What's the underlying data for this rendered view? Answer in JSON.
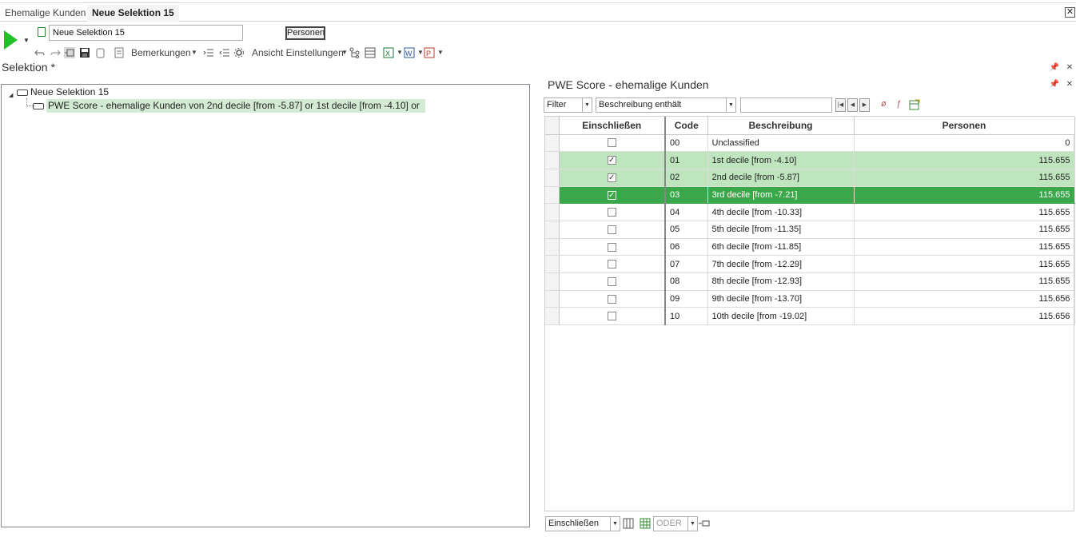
{
  "tabs": [
    {
      "label": "Ehemalige Kunden",
      "active": false
    },
    {
      "label": "Neue Selektion 15",
      "active": true
    }
  ],
  "toolbar": {
    "selection_name": "Neue Selektion 15",
    "persons_button": "Personen",
    "remarks_label": "Bemerkungen",
    "view_settings_label": "Ansicht Einstellungen"
  },
  "selection": {
    "heading": "Selektion *",
    "root": "Neue Selektion 15",
    "child": "PWE Score - ehemalige Kunden von 2nd decile [from -5.87] or 1st decile [from -4.10] or ..."
  },
  "panel": {
    "title": "PWE Score - ehemalige Kunden",
    "filter_mode": "Filter",
    "filter_field": "Beschreibung enthält",
    "filter_text": ""
  },
  "grid": {
    "columns": [
      "Einschließen",
      "Code",
      "Beschreibung",
      "Personen"
    ],
    "rows": [
      {
        "checked": false,
        "code": "00",
        "desc": "Unclassified",
        "persons": "0",
        "state": "normal"
      },
      {
        "checked": true,
        "code": "01",
        "desc": "1st decile [from -4.10]",
        "persons": "115.655",
        "state": "light"
      },
      {
        "checked": true,
        "code": "02",
        "desc": "2nd decile [from -5.87]",
        "persons": "115.655",
        "state": "light"
      },
      {
        "checked": true,
        "code": "03",
        "desc": "3rd decile [from -7.21]",
        "persons": "115.655",
        "state": "dark"
      },
      {
        "checked": false,
        "code": "04",
        "desc": "4th decile [from -10.33]",
        "persons": "115.655",
        "state": "normal"
      },
      {
        "checked": false,
        "code": "05",
        "desc": "5th decile [from -11.35]",
        "persons": "115.655",
        "state": "normal"
      },
      {
        "checked": false,
        "code": "06",
        "desc": "6th decile [from -11.85]",
        "persons": "115.655",
        "state": "normal"
      },
      {
        "checked": false,
        "code": "07",
        "desc": "7th decile [from -12.29]",
        "persons": "115.655",
        "state": "normal"
      },
      {
        "checked": false,
        "code": "08",
        "desc": "8th decile [from -12.93]",
        "persons": "115.655",
        "state": "normal"
      },
      {
        "checked": false,
        "code": "09",
        "desc": "9th decile [from -13.70]",
        "persons": "115.656",
        "state": "normal"
      },
      {
        "checked": false,
        "code": "10",
        "desc": "10th decile [from -19.02]",
        "persons": "115.656",
        "state": "normal"
      }
    ]
  },
  "footer": {
    "include_mode": "Einschließen",
    "logic": "ODER"
  },
  "colors": {
    "selected_light": "#bfe5bf",
    "selected_dark": "#3aa84a",
    "tree_highlight": "#d3ead4",
    "run_green": "#22c02a"
  }
}
